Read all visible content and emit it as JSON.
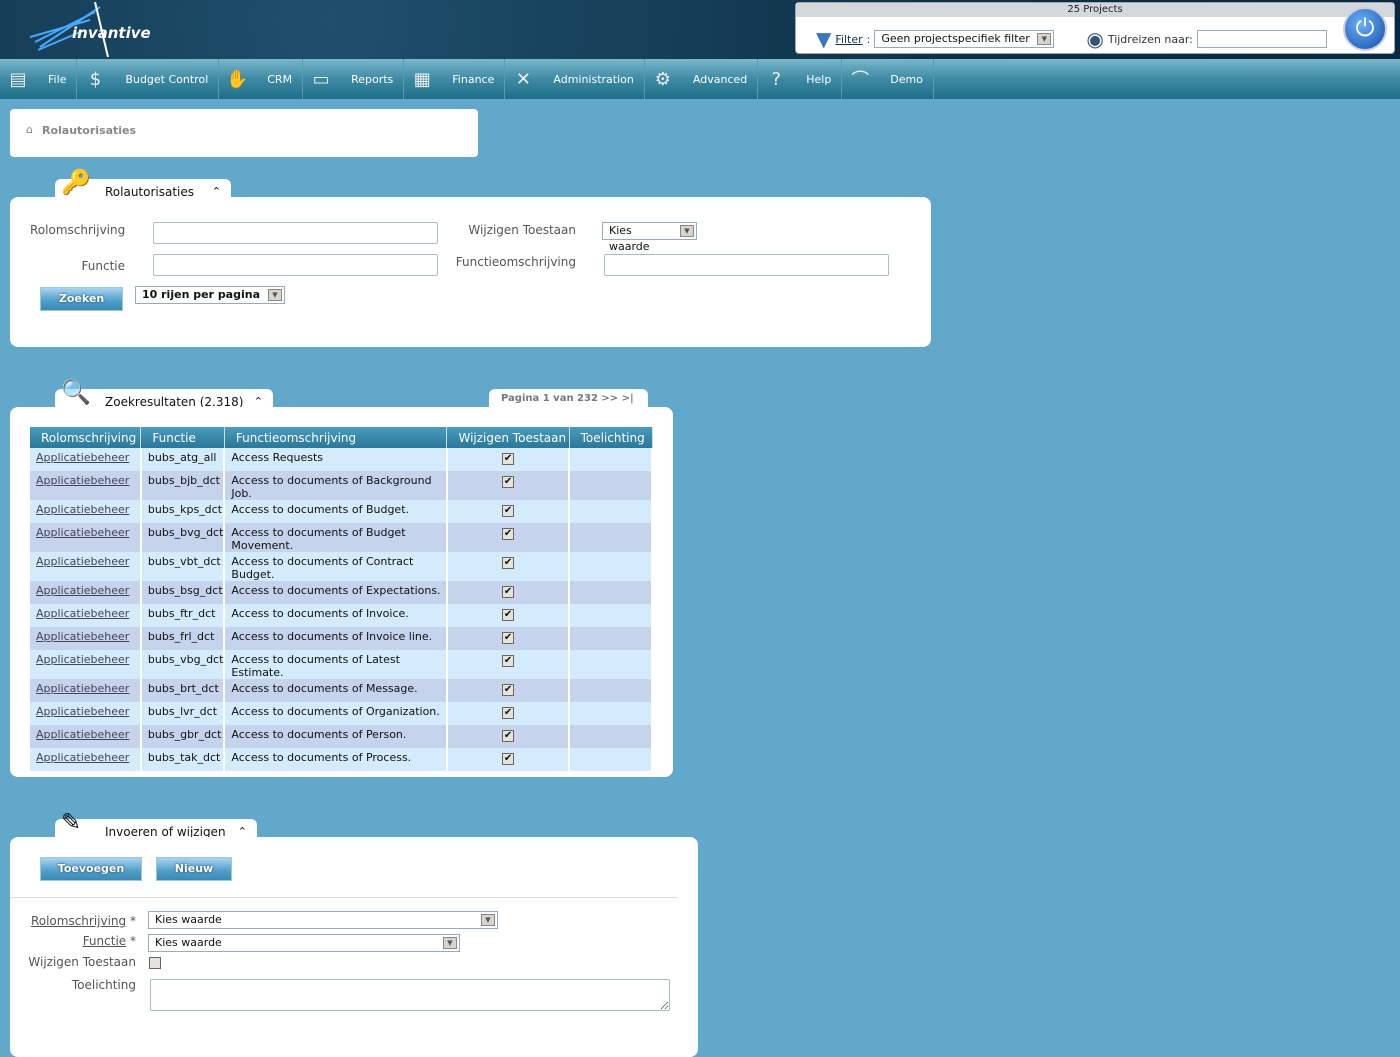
{
  "app": {
    "logo_text": "invantive"
  },
  "projects": {
    "title": "25 Projects",
    "filter_label": "Filter",
    "filter_value": "Geen projectspecifiek filter",
    "timetravel_label": "Tijdreizen naar:",
    "timetravel_value": ""
  },
  "nav": [
    {
      "label": "File",
      "icon": "file-cabinet-icon"
    },
    {
      "label": "Budget Control",
      "icon": "money-bag-icon"
    },
    {
      "label": "CRM",
      "icon": "handshake-icon"
    },
    {
      "label": "Reports",
      "icon": "presentation-icon"
    },
    {
      "label": "Finance",
      "icon": "calculator-icon"
    },
    {
      "label": "Administration",
      "icon": "tools-icon"
    },
    {
      "label": "Advanced",
      "icon": "gears-icon"
    },
    {
      "label": "Help",
      "icon": "help-icon"
    },
    {
      "label": "Demo",
      "icon": "demo-logo-icon"
    }
  ],
  "breadcrumb": "Rolautorisaties",
  "search": {
    "tab": "Rolautorisaties",
    "rol_label": "Rolomschrijving",
    "functie_label": "Functie",
    "wijzigen_label": "Wijzigen Toestaan",
    "wijzigen_value": "Kies waarde",
    "fo_label": "Functieomschrijving",
    "zoeken": "Zoeken",
    "rows_per_page": "10 rijen per pagina"
  },
  "results": {
    "tab": "Zoekresultaten (2.318)",
    "pagination": "Pagina 1 van 232  >>  >|",
    "columns": [
      "Rolomschrijving",
      "Functie",
      "Functieomschrijving",
      "Wijzigen Toestaan",
      "Toelichting"
    ],
    "rows": [
      [
        "Applicatiebeheer",
        "bubs_atg_all",
        "Access Requests",
        true,
        ""
      ],
      [
        "Applicatiebeheer",
        "bubs_bjb_dct",
        "Access to documents of Background Job.",
        true,
        ""
      ],
      [
        "Applicatiebeheer",
        "bubs_kps_dct",
        "Access to documents of Budget.",
        true,
        ""
      ],
      [
        "Applicatiebeheer",
        "bubs_bvg_dct",
        "Access to documents of Budget Movement.",
        true,
        ""
      ],
      [
        "Applicatiebeheer",
        "bubs_vbt_dct",
        "Access to documents of Contract Budget.",
        true,
        ""
      ],
      [
        "Applicatiebeheer",
        "bubs_bsg_dct",
        "Access to documents of Expectations.",
        true,
        ""
      ],
      [
        "Applicatiebeheer",
        "bubs_ftr_dct",
        "Access to documents of Invoice.",
        true,
        ""
      ],
      [
        "Applicatiebeheer",
        "bubs_frl_dct",
        "Access to documents of Invoice line.",
        true,
        ""
      ],
      [
        "Applicatiebeheer",
        "bubs_vbg_dct",
        "Access to documents of Latest Estimate.",
        true,
        ""
      ],
      [
        "Applicatiebeheer",
        "bubs_brt_dct",
        "Access to documents of Message.",
        true,
        ""
      ],
      [
        "Applicatiebeheer",
        "bubs_lvr_dct",
        "Access to documents of Organization.",
        true,
        ""
      ],
      [
        "Applicatiebeheer",
        "bubs_gbr_dct",
        "Access to documents of Person.",
        true,
        ""
      ],
      [
        "Applicatiebeheer",
        "bubs_tak_dct",
        "Access to documents of Process.",
        true,
        ""
      ]
    ]
  },
  "edit": {
    "tab": "Invoeren of wijzigen",
    "add": "Toevoegen",
    "new": "Nieuw",
    "rol_label": "Rolomschrijving",
    "functie_label": "Functie",
    "req": "*",
    "rol_value": "Kies waarde",
    "functie_value": "Kies waarde",
    "wijzigen_label": "Wijzigen Toestaan",
    "toelichting_label": "Toelichting"
  }
}
